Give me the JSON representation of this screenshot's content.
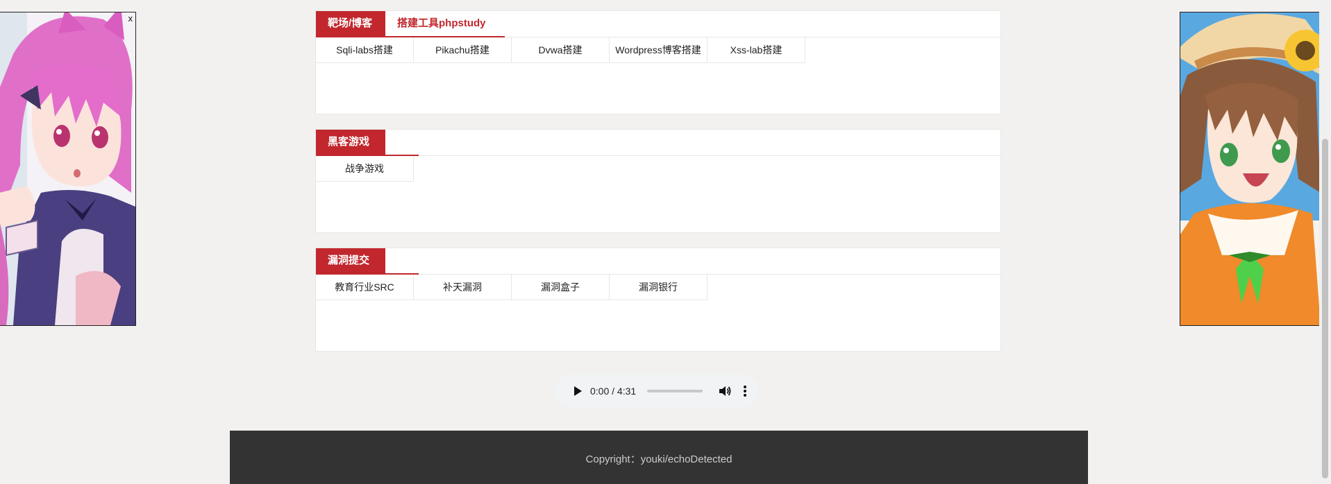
{
  "ads": {
    "close_label": "x"
  },
  "panels": [
    {
      "tabs": [
        {
          "label": "靶场/博客",
          "active": true
        },
        {
          "label": "搭建工具phpstudy",
          "active": false
        }
      ],
      "items": [
        "Sqli-labs搭建",
        "Pikachu搭建",
        "Dvwa搭建",
        "Wordpress博客搭建",
        "Xss-lab搭建"
      ]
    },
    {
      "tabs": [
        {
          "label": "黑客游戏",
          "active": true
        }
      ],
      "items": [
        "战争游戏"
      ]
    },
    {
      "tabs": [
        {
          "label": "漏洞提交",
          "active": true
        }
      ],
      "items": [
        "教育行业SRC",
        "补天漏洞",
        "漏洞盒子",
        "漏洞银行"
      ]
    }
  ],
  "audio": {
    "time": "0:00 / 4:31",
    "progress": 0
  },
  "footer": {
    "copyright": "Copyright：youki/echoDetected"
  },
  "colors": {
    "accent": "#c1272d",
    "background": "#f2f1f0",
    "footer": "#333333"
  }
}
